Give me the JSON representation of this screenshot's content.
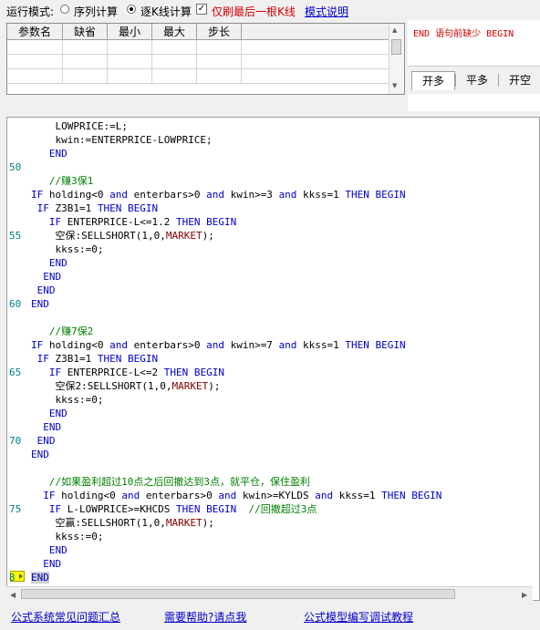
{
  "toolbar": {
    "run_mode_label": "运行模式:",
    "option_sequence": "序列计算",
    "option_kline": "逐K线计算",
    "selected_mode": "逐K线计算",
    "refresh_last_label": "仅刷最后一根K线",
    "refresh_last_checked": true,
    "mode_help_link": "模式说明"
  },
  "param_table": {
    "columns": [
      "参数名",
      "缺省",
      "最小",
      "最大",
      "步长"
    ],
    "rows": []
  },
  "message_panel": {
    "error_text": "END 语句前缺少 BEGIN",
    "tabs": [
      "开多",
      "平多",
      "开空"
    ],
    "active_tab": "开多"
  },
  "editor": {
    "line_numbers": [
      {
        "label": "50",
        "row": 3
      },
      {
        "label": "55",
        "row": 8
      },
      {
        "label": "60",
        "row": 13
      },
      {
        "label": "65",
        "row": 18
      },
      {
        "label": "70",
        "row": 23
      },
      {
        "label": "75",
        "row": 28
      },
      {
        "label": "8",
        "row": 33
      }
    ],
    "lines": [
      [
        {
          "t": "    LOWPRICE:=L;"
        }
      ],
      [
        {
          "t": "    kwin:=ENTERPRICE-LOWPRICE;"
        }
      ],
      [
        {
          "t": "   "
        },
        {
          "t": "END",
          "c": "kw"
        }
      ],
      [
        {
          "t": ""
        }
      ],
      [
        {
          "t": "   "
        },
        {
          "t": "//赚3保1",
          "c": "cm"
        }
      ],
      [
        {
          "t": "IF",
          "c": "kw"
        },
        {
          "t": " holding<0 "
        },
        {
          "t": "and",
          "c": "kw"
        },
        {
          "t": " enterbars>0 "
        },
        {
          "t": "and",
          "c": "kw"
        },
        {
          "t": " kwin>=3 "
        },
        {
          "t": "and",
          "c": "kw"
        },
        {
          "t": " kkss=1 "
        },
        {
          "t": "THEN BEGIN",
          "c": "kw"
        }
      ],
      [
        {
          "t": " "
        },
        {
          "t": "IF",
          "c": "kw"
        },
        {
          "t": " Z3B1=1 "
        },
        {
          "t": "THEN BEGIN",
          "c": "kw"
        }
      ],
      [
        {
          "t": "   "
        },
        {
          "t": "IF",
          "c": "kw"
        },
        {
          "t": " ENTERPRICE-L<=1.2 "
        },
        {
          "t": "THEN BEGIN",
          "c": "kw"
        }
      ],
      [
        {
          "t": "    空保:SELLSHORT(1,0,"
        },
        {
          "t": "MARKET",
          "c": "fn"
        },
        {
          "t": ");"
        }
      ],
      [
        {
          "t": "    kkss:=0;"
        }
      ],
      [
        {
          "t": "   "
        },
        {
          "t": "END",
          "c": "kw"
        }
      ],
      [
        {
          "t": "  "
        },
        {
          "t": "END",
          "c": "kw"
        }
      ],
      [
        {
          "t": " "
        },
        {
          "t": "END",
          "c": "kw"
        }
      ],
      [
        {
          "t": "END",
          "c": "kw"
        }
      ],
      [
        {
          "t": ""
        }
      ],
      [
        {
          "t": "   "
        },
        {
          "t": "//赚7保2",
          "c": "cm"
        }
      ],
      [
        {
          "t": "IF",
          "c": "kw"
        },
        {
          "t": " holding<0 "
        },
        {
          "t": "and",
          "c": "kw"
        },
        {
          "t": " enterbars>0 "
        },
        {
          "t": "and",
          "c": "kw"
        },
        {
          "t": " kwin>=7 "
        },
        {
          "t": "and",
          "c": "kw"
        },
        {
          "t": " kkss=1 "
        },
        {
          "t": "THEN BEGIN",
          "c": "kw"
        }
      ],
      [
        {
          "t": " "
        },
        {
          "t": "IF",
          "c": "kw"
        },
        {
          "t": " Z3B1=1 "
        },
        {
          "t": "THEN BEGIN",
          "c": "kw"
        }
      ],
      [
        {
          "t": "   "
        },
        {
          "t": "IF",
          "c": "kw"
        },
        {
          "t": " ENTERPRICE-L<=2 "
        },
        {
          "t": "THEN BEGIN",
          "c": "kw"
        }
      ],
      [
        {
          "t": "    空保2:SELLSHORT(1,0,"
        },
        {
          "t": "MARKET",
          "c": "fn"
        },
        {
          "t": ");"
        }
      ],
      [
        {
          "t": "    kkss:=0;"
        }
      ],
      [
        {
          "t": "   "
        },
        {
          "t": "END",
          "c": "kw"
        }
      ],
      [
        {
          "t": "  "
        },
        {
          "t": "END",
          "c": "kw"
        }
      ],
      [
        {
          "t": " "
        },
        {
          "t": "END",
          "c": "kw"
        }
      ],
      [
        {
          "t": "END",
          "c": "kw"
        }
      ],
      [
        {
          "t": ""
        }
      ],
      [
        {
          "t": "   "
        },
        {
          "t": "//如果盈利超过10点之后回撤达到3点，就平仓，保住盈利",
          "c": "cm"
        }
      ],
      [
        {
          "t": "  "
        },
        {
          "t": "IF",
          "c": "kw"
        },
        {
          "t": " holding<0 "
        },
        {
          "t": "and",
          "c": "kw"
        },
        {
          "t": " enterbars>0 "
        },
        {
          "t": "and",
          "c": "kw"
        },
        {
          "t": " kwin>=KYLDS "
        },
        {
          "t": "and",
          "c": "kw"
        },
        {
          "t": " kkss=1 "
        },
        {
          "t": "THEN BEGIN",
          "c": "kw"
        }
      ],
      [
        {
          "t": "   "
        },
        {
          "t": "IF",
          "c": "kw"
        },
        {
          "t": " L-LOWPRICE>=KHCDS "
        },
        {
          "t": "THEN BEGIN",
          "c": "kw"
        },
        {
          "t": "  "
        },
        {
          "t": "//回撤超过3点",
          "c": "cm"
        }
      ],
      [
        {
          "t": "    空赢:SELLSHORT(1,0,"
        },
        {
          "t": "MARKET",
          "c": "fn"
        },
        {
          "t": ");"
        }
      ],
      [
        {
          "t": "    kkss:=0;"
        }
      ],
      [
        {
          "t": "   "
        },
        {
          "t": "END",
          "c": "kw"
        }
      ],
      [
        {
          "t": "  "
        },
        {
          "t": "END",
          "c": "kw"
        }
      ],
      [
        {
          "t": "END",
          "c": "kw",
          "h": true
        }
      ]
    ]
  },
  "footer": {
    "link_faq": "公式系统常见问题汇总",
    "link_help": "需要帮助?请点我",
    "link_tutorial": "公式模型编写调试教程"
  }
}
